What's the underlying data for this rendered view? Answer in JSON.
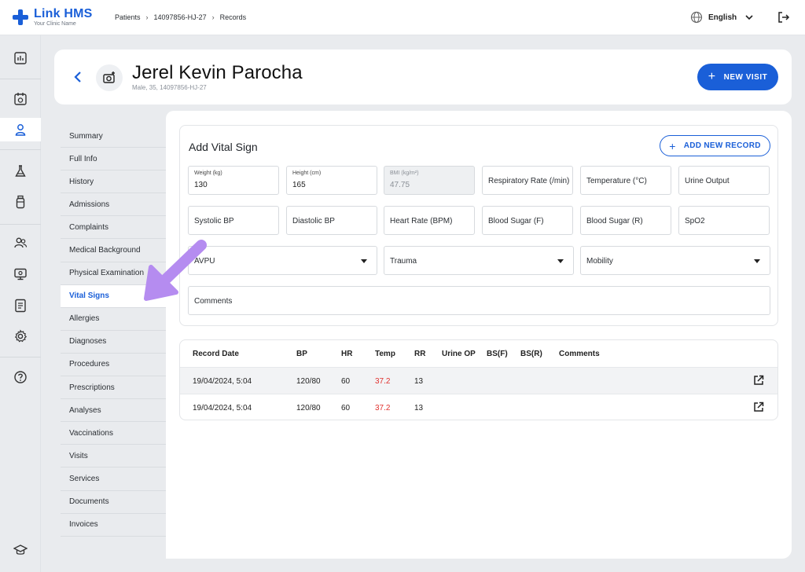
{
  "app": {
    "logo_title": "Link HMS",
    "logo_subtitle": "Your Clinic Name",
    "brand_color": "#1a5fd8"
  },
  "breadcrumb": [
    "Patients",
    "14097856-HJ-27",
    "Records"
  ],
  "language": "English",
  "rail_icons": [
    "dashboard-icon",
    "calendar-icon",
    "patient-icon",
    "lab-flask-icon",
    "medicine-bottle-icon",
    "staff-icon",
    "monitor-icon",
    "report-icon",
    "settings-icon",
    "help-icon",
    "graduation-cap-icon"
  ],
  "patient": {
    "name": "Jerel Kevin Parocha",
    "meta": "Male, 35, 14097856-HJ-27"
  },
  "header": {
    "new_visit_label": "NEW VISIT"
  },
  "side_nav": {
    "items": [
      "Summary",
      "Full Info",
      "History",
      "Admissions",
      "Complaints",
      "Medical Background",
      "Physical Examination",
      "Vital Signs",
      "Allergies",
      "Diagnoses",
      "Procedures",
      "Prescriptions",
      "Analyses",
      "Vaccinations",
      "Visits",
      "Services",
      "Documents",
      "Invoices"
    ],
    "active": "Vital Signs"
  },
  "vital_form": {
    "title": "Add Vital Sign",
    "add_record_label": "ADD NEW RECORD",
    "weight": {
      "label": "Weight (kg)",
      "value": "130"
    },
    "height": {
      "label": "Height (cm)",
      "value": "165"
    },
    "bmi": {
      "label": "BMI (kg/m²)",
      "value": "47.75"
    },
    "respiratory_rate": "Respiratory Rate (/min)",
    "temperature": "Temperature (°C)",
    "urine_output": "Urine Output",
    "systolic_bp": "Systolic BP",
    "diastolic_bp": "Diastolic BP",
    "heart_rate": "Heart Rate (BPM)",
    "blood_sugar_f": "Blood Sugar (F)",
    "blood_sugar_r": "Blood Sugar (R)",
    "spo2": "SpO2",
    "avpu": "AVPU",
    "trauma": "Trauma",
    "mobility": "Mobility",
    "comments": "Comments"
  },
  "records_table": {
    "headers": [
      "Record Date",
      "BP",
      "HR",
      "Temp",
      "RR",
      "Urine OP",
      "BS(F)",
      "BS(R)",
      "Comments"
    ],
    "rows": [
      {
        "date": "19/04/2024, 5:04",
        "bp": "120/80",
        "hr": "60",
        "temp": "37.2",
        "rr": "13",
        "urine_op": "",
        "bs_f": "",
        "bs_r": "",
        "comments": ""
      },
      {
        "date": "19/04/2024, 5:04",
        "bp": "120/80",
        "hr": "60",
        "temp": "37.2",
        "rr": "13",
        "urine_op": "",
        "bs_f": "",
        "bs_r": "",
        "comments": ""
      }
    ],
    "temp_color": "#e0322f"
  },
  "overlay": {
    "arrow_color": "#b58cf0"
  }
}
